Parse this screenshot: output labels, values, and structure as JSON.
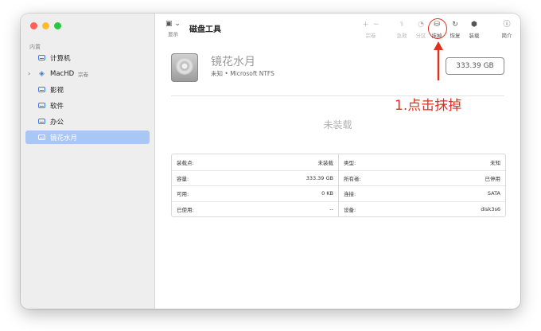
{
  "sidebar": {
    "section": "内置",
    "items": [
      {
        "label": "计算机",
        "sub": ""
      },
      {
        "label": "MacHD",
        "sub": "宗卷"
      },
      {
        "label": "影视",
        "sub": ""
      },
      {
        "label": "软件",
        "sub": ""
      },
      {
        "label": "办公",
        "sub": ""
      },
      {
        "label": "镜花水月",
        "sub": ""
      }
    ]
  },
  "toolbar": {
    "view_label": "显示",
    "title": "磁盘工具",
    "add_icon": "+",
    "remove_icon": "−",
    "volume_label": "宗卷",
    "firstaid_label": "急救",
    "partition_label": "分区",
    "erase_label": "抹掉",
    "restore_label": "恢复",
    "mount_label": "装载",
    "info_label": "简介"
  },
  "volume": {
    "name": "镜花水月",
    "desc": "未知 • Microsoft NTFS",
    "size": "333.39 GB",
    "status": "未装载"
  },
  "info": {
    "left": [
      {
        "label": "装载点:",
        "value": "未装载"
      },
      {
        "label": "容量:",
        "value": "333.39 GB"
      },
      {
        "label": "可用:",
        "value": "0 KB"
      },
      {
        "label": "已使用:",
        "value": "--"
      }
    ],
    "right": [
      {
        "label": "类型:",
        "value": "未知"
      },
      {
        "label": "所有者:",
        "value": "已停用"
      },
      {
        "label": "连接:",
        "value": "SATA"
      },
      {
        "label": "设备:",
        "value": "disk3s6"
      }
    ]
  },
  "annotation": "1.点击抹掉",
  "colors": {
    "accent": "#3d7be0",
    "selection": "#a8c7f5",
    "annotation": "#e0301e",
    "close": "#ff5f57",
    "minimize": "#febc2e",
    "zoom": "#28c840"
  }
}
